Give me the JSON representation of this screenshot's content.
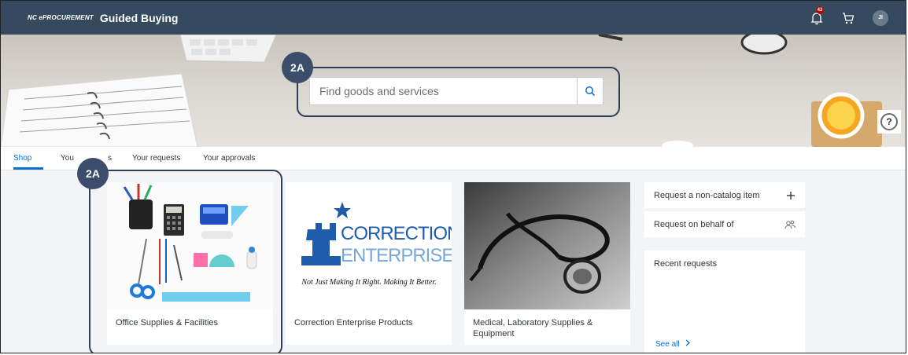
{
  "header": {
    "brand": "NC ePROCUREMENT",
    "title": "Guided Buying",
    "notification_count": "43",
    "avatar_initials": "JI"
  },
  "search": {
    "placeholder": "Find goods and services"
  },
  "help": {
    "label": "?"
  },
  "tabs": [
    {
      "label": "Shop",
      "active": true
    },
    {
      "label": "Your carts",
      "active": false
    },
    {
      "label": "Your requests",
      "active": false
    },
    {
      "label": "Your approvals",
      "active": false
    }
  ],
  "tab_visible_fragment": "s",
  "tab_visible_prefix": "You",
  "cards": [
    {
      "label": "Office Supplies & Facilities"
    },
    {
      "label": "Correction Enterprise Products"
    },
    {
      "label": "Medical, Laboratory Supplies & Equipment"
    }
  ],
  "logo": {
    "line1": "CORRECTION",
    "line2": "ENTERPRISES",
    "tagline": "Not Just Making It Right. Making It Better."
  },
  "side_panel": {
    "non_catalog": "Request a non-catalog item",
    "on_behalf": "Request on behalf of",
    "recent_title": "Recent requests",
    "see_all": "See all"
  },
  "callouts": [
    {
      "label": "2A"
    },
    {
      "label": "2A"
    }
  ],
  "colors": {
    "shell": "#354a5f",
    "accent": "#0a6ed1",
    "callout": "#3b4d6a"
  }
}
